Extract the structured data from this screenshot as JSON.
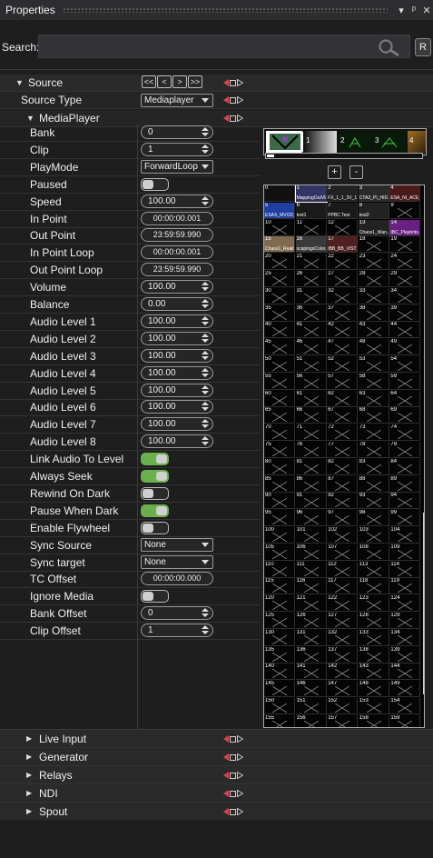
{
  "window": {
    "title": "Properties",
    "icons": [
      "dropdown-icon",
      "pin-icon",
      "close-icon"
    ]
  },
  "search": {
    "label": "Search:",
    "value": "",
    "reset_label": "R"
  },
  "groups": {
    "source": {
      "label": "Source",
      "expanded": true,
      "nav": [
        "<<",
        "<",
        ">",
        ">>"
      ]
    },
    "source_type": {
      "label": "Source Type",
      "value": "Mediaplayer"
    },
    "mediaplayer": {
      "label": "MediaPlayer",
      "expanded": true
    }
  },
  "properties": [
    {
      "label": "Bank",
      "kind": "spin",
      "value": "0"
    },
    {
      "label": "Clip",
      "kind": "spin",
      "value": "1"
    },
    {
      "label": "PlayMode",
      "kind": "dropdown",
      "value": "ForwardLoop"
    },
    {
      "label": "Paused",
      "kind": "toggle",
      "value": false
    },
    {
      "label": "Speed",
      "kind": "spin",
      "value": "100.00"
    },
    {
      "label": "In Point",
      "kind": "timecode",
      "value": "00:00:00.001"
    },
    {
      "label": "Out Point",
      "kind": "timecode",
      "value": "23:59:59.990"
    },
    {
      "label": "In Point Loop",
      "kind": "timecode",
      "value": "00:00:00.001"
    },
    {
      "label": "Out Point Loop",
      "kind": "timecode",
      "value": "23:59:59.990"
    },
    {
      "label": "Volume",
      "kind": "spin",
      "value": "100.00"
    },
    {
      "label": "Balance",
      "kind": "spin",
      "value": "0.00"
    },
    {
      "label": "Audio Level 1",
      "kind": "spin",
      "value": "100.00"
    },
    {
      "label": "Audio Level 2",
      "kind": "spin",
      "value": "100.00"
    },
    {
      "label": "Audio Level 3",
      "kind": "spin",
      "value": "100.00"
    },
    {
      "label": "Audio Level 4",
      "kind": "spin",
      "value": "100.00"
    },
    {
      "label": "Audio Level 5",
      "kind": "spin",
      "value": "100.00"
    },
    {
      "label": "Audio Level 6",
      "kind": "spin",
      "value": "100.00"
    },
    {
      "label": "Audio Level 7",
      "kind": "spin",
      "value": "100.00"
    },
    {
      "label": "Audio Level 8",
      "kind": "spin",
      "value": "100.00"
    },
    {
      "label": "Link Audio To Level",
      "kind": "toggle",
      "value": true
    },
    {
      "label": "Always Seek",
      "kind": "toggle",
      "value": true
    },
    {
      "label": "Rewind On Dark",
      "kind": "toggle",
      "value": false
    },
    {
      "label": "Pause When Dark",
      "kind": "toggle",
      "value": true
    },
    {
      "label": "Enable Flywheel",
      "kind": "toggle",
      "value": false
    },
    {
      "label": "Sync Source",
      "kind": "dropdown",
      "value": "None"
    },
    {
      "label": "Sync target",
      "kind": "dropdown",
      "value": "None"
    },
    {
      "label": "TC Offset",
      "kind": "timecode",
      "value": "00:00:00.000"
    },
    {
      "label": "Ignore Media",
      "kind": "toggle",
      "value": false
    },
    {
      "label": "Bank Offset",
      "kind": "spin",
      "value": "0"
    },
    {
      "label": "Clip Offset",
      "kind": "spin",
      "value": "1"
    }
  ],
  "bank_strip": {
    "slots": [
      "1",
      "2",
      "3",
      "4"
    ],
    "add_label": "+",
    "remove_label": "-"
  },
  "clip_grid": {
    "first_visible": 0,
    "named_clips": {
      "1": "MappingOutVE...",
      "2": "FX_1_1_3V_1_...",
      "3": "CTA3_PI_HID...",
      "4": "ESA_NI_ACE_...",
      "5": "ESAS_MVOD_...",
      "6": "test1",
      "7": "PPBC Test",
      "8": "test2",
      "13": "Chaos1_Wan...",
      "14": "IBC_Playbrito...",
      "15": "Chaos1_Realm...",
      "16": "scapingsColor...",
      "17": "IBB_BB_VIST_1..."
    },
    "filled": [
      0,
      1,
      2,
      3,
      4,
      5,
      6,
      7,
      8,
      13,
      14,
      15,
      16,
      17
    ]
  },
  "sections": [
    {
      "label": "Live Input"
    },
    {
      "label": "Generator"
    },
    {
      "label": "Relays"
    },
    {
      "label": "NDI"
    },
    {
      "label": "Spout"
    }
  ]
}
